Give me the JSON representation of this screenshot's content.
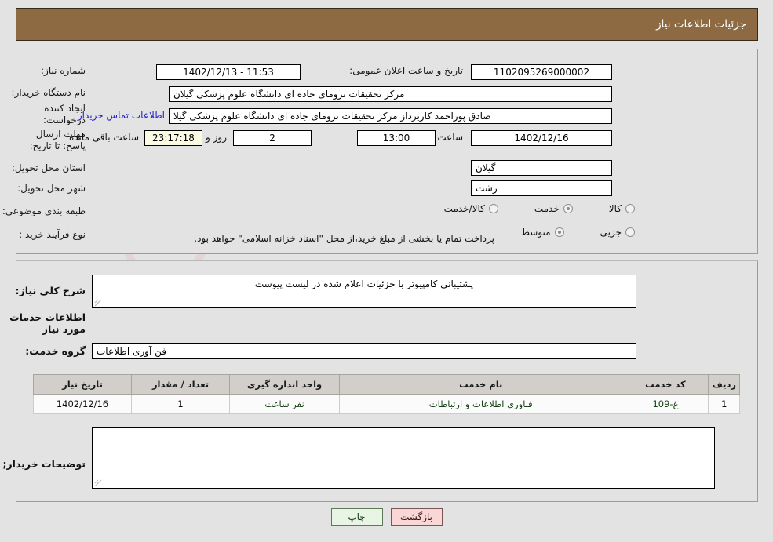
{
  "header": {
    "title": "جزئیات اطلاعات نیاز"
  },
  "watermark": {
    "text": "AriaTender.net"
  },
  "form": {
    "need_number_label": "شماره نیاز:",
    "need_number_value": "1102095269000002",
    "announce_label": "تاریخ و ساعت اعلان عمومی:",
    "announce_value": "11:53 - 1402/12/13",
    "buyer_org_label": "نام دستگاه خریدار:",
    "buyer_org_value": "مرکز تحقیقات ترومای جاده ای دانشگاه علوم پزشکی گیلان",
    "creator_label": "ایجاد کننده درخواست:",
    "creator_value": "صادق پوراحمد کاربرداز مرکز تحقیقات ترومای جاده ای دانشگاه علوم پزشکی گیلا",
    "contact_link": "اطلاعات تماس خریدار",
    "deadline_label": "مهلت ارسال پاسخ: تا تاریخ:",
    "deadline_date": "1402/12/16",
    "hour_label": "ساعت",
    "hour_value": "13:00",
    "days_value": "2",
    "days_unit_label": "روز و",
    "countdown_value": "23:17:18",
    "remaining_label": "ساعت باقی مانده",
    "province_label": "استان محل تحویل:",
    "province_value": "گیلان",
    "city_label": "شهر محل تحویل:",
    "city_value": "رشت",
    "category_label": "طبقه بندی موضوعی:",
    "category_options": [
      {
        "label": "کالا",
        "selected": false
      },
      {
        "label": "خدمت",
        "selected": true
      },
      {
        "label": "کالا/خدمت",
        "selected": false
      }
    ],
    "process_label": "نوع فرآیند خرید :",
    "process_options": [
      {
        "label": "جزیی",
        "selected": false
      },
      {
        "label": "متوسط",
        "selected": true
      }
    ],
    "treasury_note": "پرداخت تمام یا بخشی از مبلغ خرید،از محل \"اسناد خزانه اسلامی\" خواهد بود."
  },
  "middle": {
    "summary_label": "شرح کلی نیاز:",
    "summary_value": "پشتیبانی کامپیوتر با جزئیات اعلام شده در لیست پیوست",
    "services_heading": "اطلاعات خدمات مورد نیاز",
    "service_group_label": "گروه خدمت:",
    "service_group_value": "فن آوری اطلاعات",
    "buyer_notes_label": "توضیحات خریدار;",
    "buyer_notes_value": ""
  },
  "table": {
    "columns": [
      "ردیف",
      "کد خدمت",
      "نام خدمت",
      "واحد اندازه گیری",
      "تعداد / مقدار",
      "تاریخ نیاز"
    ],
    "rows": [
      {
        "radif": "1",
        "code": "غ-109",
        "name": "فناوری اطلاعات و ارتباطات",
        "unit": "نفر ساعت",
        "qty": "1",
        "date": "1402/12/16"
      }
    ]
  },
  "buttons": {
    "print": "چاپ",
    "back": "بازگشت"
  },
  "colors": {
    "header_bg": "#8d6a41",
    "link": "#2222cc",
    "countdown_bg": "#fbfbe4",
    "print_bg": "#e8f5e4",
    "back_bg": "#f9d7d7"
  }
}
